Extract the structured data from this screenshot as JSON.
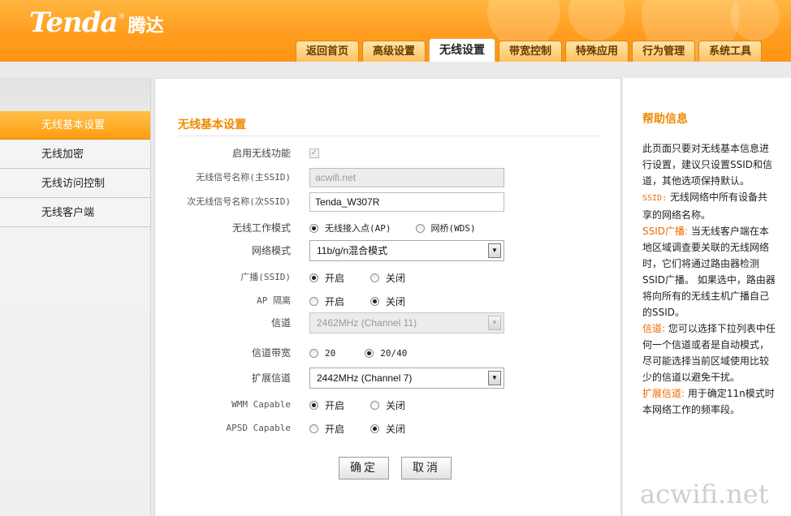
{
  "header": {
    "logo_text": "Tenda",
    "logo_cn": "腾达",
    "tabs": [
      {
        "label": "返回首页"
      },
      {
        "label": "高级设置"
      },
      {
        "label": "无线设置"
      },
      {
        "label": "带宽控制"
      },
      {
        "label": "特殊应用"
      },
      {
        "label": "行为管理"
      },
      {
        "label": "系统工具"
      }
    ],
    "active_tab": "无线设置"
  },
  "sidebar": {
    "items": [
      {
        "label": "无线基本设置"
      },
      {
        "label": "无线加密"
      },
      {
        "label": "无线访问控制"
      },
      {
        "label": "无线客户端"
      }
    ],
    "active_item": "无线基本设置"
  },
  "form": {
    "title": "无线基本设置",
    "enable_wireless": {
      "label": "启用无线功能",
      "checked": true
    },
    "primary_ssid": {
      "label": "无线信号名称(主SSID)",
      "value": "acwifi.net"
    },
    "secondary_ssid": {
      "label": "次无线信号名称(次SSID)",
      "value": "Tenda_W307R"
    },
    "work_mode": {
      "label": "无线工作模式",
      "options": [
        "无线接入点(AP)",
        "网桥(WDS)"
      ],
      "selected": "无线接入点(AP)"
    },
    "network_mode": {
      "label": "网络模式",
      "value": "11b/g/n混合模式"
    },
    "ssid_broadcast": {
      "label": "广播(SSID)",
      "on_label": "开启",
      "off_label": "关闭",
      "selected": "开启"
    },
    "ap_isolation": {
      "label": "AP 隔离",
      "on_label": "开启",
      "off_label": "关闭",
      "selected": "关闭"
    },
    "channel": {
      "label": "信道",
      "value": "2462MHz (Channel 11)"
    },
    "bandwidth": {
      "label": "信道带宽",
      "options": [
        "20",
        "20/40"
      ],
      "selected": "20/40"
    },
    "ext_channel": {
      "label": "扩展信道",
      "value": "2442MHz (Channel 7)"
    },
    "wmm": {
      "label": "WMM Capable",
      "on_label": "开启",
      "off_label": "关闭",
      "selected": "开启"
    },
    "apsd": {
      "label": "APSD Capable",
      "on_label": "开启",
      "off_label": "关闭",
      "selected": "关闭"
    },
    "ok_label": "确定",
    "cancel_label": "取消"
  },
  "help": {
    "title": "帮助信息",
    "intro": "此页面只要对无线基本信息进行设置，建议只设置SSID和信道，其他选项保持默认。",
    "ssid_kw": "SSID:",
    "ssid_text": "无线网络中所有设备共享的网络名称。",
    "broadcast_kw": "SSID广播:",
    "broadcast_text": "当无线客户端在本地区域调查要关联的无线网络时，它们将通过路由器检测SSID广播。 如果选中，路由器将向所有的无线主机广播自己的SSID。",
    "channel_kw": "信道:",
    "channel_text": "您可以选择下拉列表中任何一个信道或者是自动模式，尽可能选择当前区域使用比较少的信道以避免干扰。",
    "ext_kw": "扩展信道:",
    "ext_text": "用于确定11n模式时本网络工作的频率段。"
  },
  "watermark": "acwifi.net"
}
